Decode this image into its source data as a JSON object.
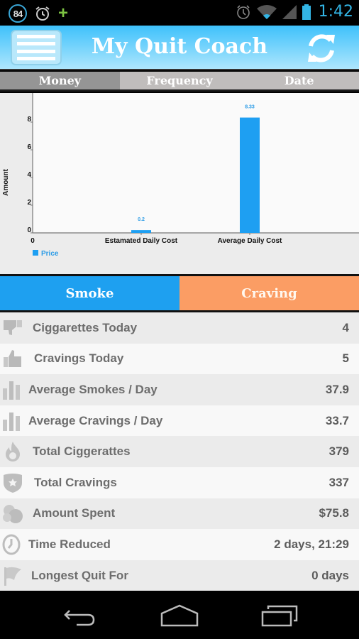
{
  "status_bar": {
    "notification_badge": "84",
    "time": "1:42",
    "left_icons": [
      "badge-84-icon",
      "alarm-clock-icon",
      "plus-icon"
    ],
    "right_icons": [
      "alarm-icon",
      "wifi-icon",
      "cell-signal-icon",
      "battery-icon"
    ]
  },
  "header": {
    "title": "My Quit Coach",
    "menu_icon": "hamburger-menu-icon",
    "refresh_icon": "refresh-icon"
  },
  "tabs": [
    {
      "label": "Money",
      "active": true
    },
    {
      "label": "Frequency",
      "active": false
    },
    {
      "label": "Date",
      "active": false
    }
  ],
  "chart_data": {
    "type": "bar",
    "title": "",
    "xlabel": "",
    "ylabel": "Amount",
    "categories": [
      "Estamated Daily Cost",
      "Average Daily Cost"
    ],
    "series": [
      {
        "name": "Price",
        "values": [
          0.2,
          8.33
        ],
        "color": "#1e9ff2"
      }
    ],
    "data_labels": [
      "0.2",
      "8.33"
    ],
    "x_origin_label": "0",
    "y_ticks": [
      0,
      2,
      4,
      6,
      8
    ],
    "ylim": [
      0,
      10
    ],
    "grid": false,
    "legend": "bottom-left"
  },
  "actions": {
    "smoke_label": "Smoke",
    "craving_label": "Craving",
    "smoke_color": "#1ea0f0",
    "craving_color": "#fb9d64"
  },
  "stats": [
    {
      "icon": "thumbs-down-icon",
      "label": "Ciggarettes Today",
      "value": "4"
    },
    {
      "icon": "thumbs-up-icon",
      "label": "Cravings Today",
      "value": "5"
    },
    {
      "icon": "bar-chart-icon",
      "label": "Average Smokes / Day",
      "value": "37.9"
    },
    {
      "icon": "bar-chart-icon",
      "label": "Average Cravings / Day",
      "value": "33.7"
    },
    {
      "icon": "flame-icon",
      "label": "Total Ciggerattes",
      "value": "379"
    },
    {
      "icon": "shield-star-icon",
      "label": "Total Cravings",
      "value": "337"
    },
    {
      "icon": "coins-icon",
      "label": "Amount Spent",
      "value": "$75.8"
    },
    {
      "icon": "clock-icon",
      "label": "Time Reduced",
      "value": "2 days, 21:29"
    },
    {
      "icon": "flag-icon",
      "label": "Longest Quit For",
      "value": "0 days"
    }
  ],
  "nav_bar": {
    "back_icon": "back-icon",
    "home_icon": "home-icon",
    "recents_icon": "recent-apps-icon"
  }
}
